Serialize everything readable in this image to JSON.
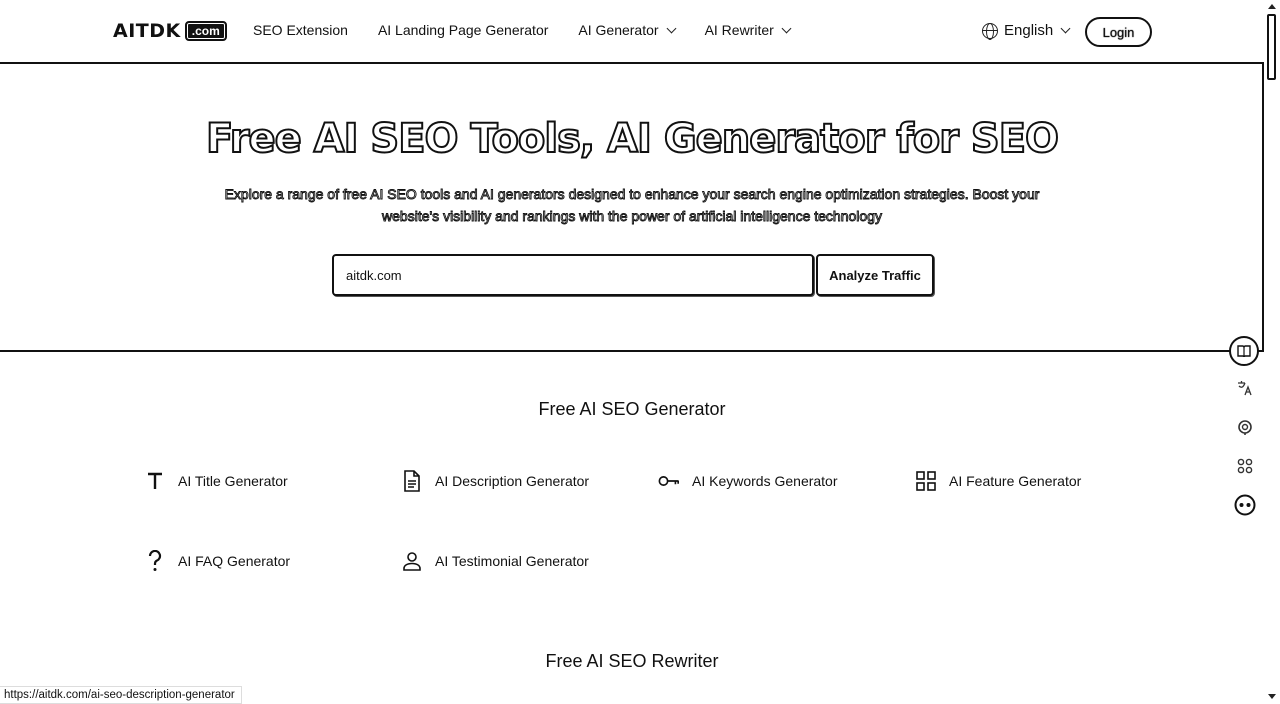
{
  "header": {
    "logo_text": "AITDK",
    "logo_badge": ".com",
    "nav": [
      {
        "label": "SEO Extension",
        "dropdown": false
      },
      {
        "label": "AI Landing Page Generator",
        "dropdown": false
      },
      {
        "label": "AI Generator",
        "dropdown": true
      },
      {
        "label": "AI Rewriter",
        "dropdown": true
      }
    ],
    "language": "English",
    "login_label": "Login"
  },
  "hero": {
    "title": "Free AI SEO Tools, AI Generator for SEO",
    "subtitle": "Explore a range of free AI SEO tools and AI generators designed to enhance your search engine optimization strategies. Boost your website's visibility and rankings with the power of artificial intelligence technology",
    "search_value": "aitdk.com",
    "analyze_label": "Analyze Traffic"
  },
  "generator_section": {
    "title": "Free AI SEO Generator",
    "tools": [
      {
        "label": "AI Title Generator",
        "icon": "title-icon"
      },
      {
        "label": "AI Description Generator",
        "icon": "document-icon"
      },
      {
        "label": "AI Keywords Generator",
        "icon": "key-icon"
      },
      {
        "label": "AI Feature Generator",
        "icon": "grid-icon"
      },
      {
        "label": "AI FAQ Generator",
        "icon": "question-icon"
      },
      {
        "label": "AI Testimonial Generator",
        "icon": "user-icon"
      }
    ]
  },
  "rewriter_section": {
    "title": "Free AI SEO Rewriter"
  },
  "side_tools": [
    "book-icon",
    "translate-icon",
    "assistant-icon",
    "apps-icon",
    "robot-icon"
  ],
  "status_url": "https://aitdk.com/ai-seo-description-generator"
}
